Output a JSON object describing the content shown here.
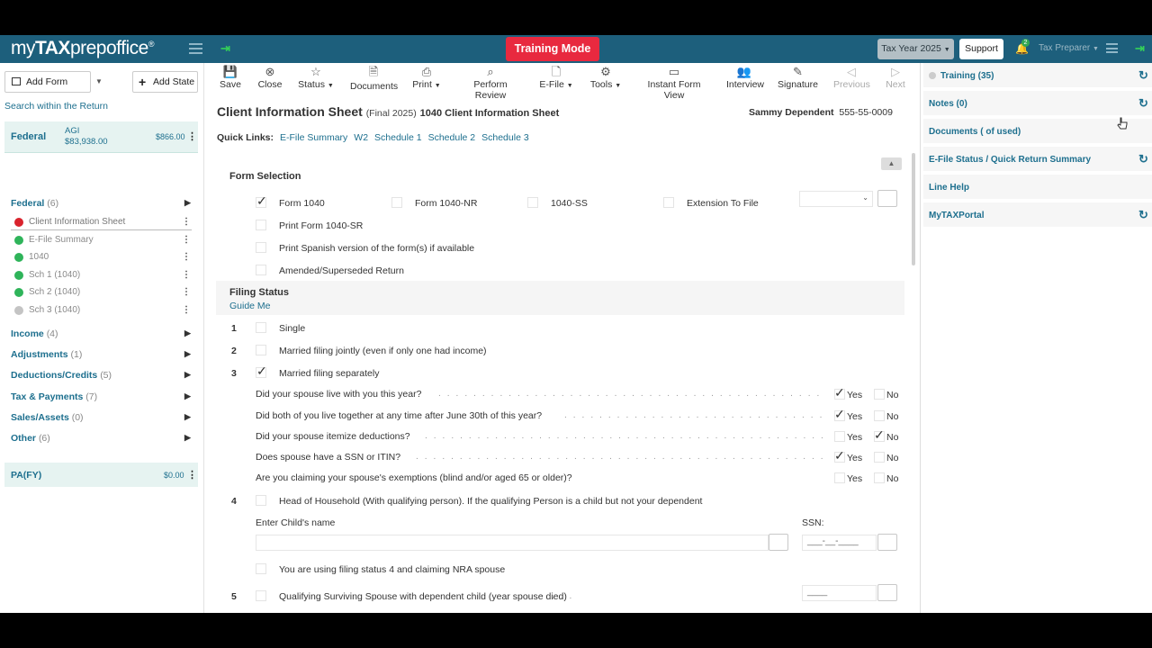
{
  "topbar": {
    "logo_my": "my",
    "logo_tax": "TAX",
    "logo_rest": "prepoffice",
    "logo_reg": "®",
    "training_mode": "Training Mode",
    "tax_year": "Tax Year 2025",
    "support": "Support",
    "notif_count": "2",
    "user_menu": "Tax Preparer"
  },
  "left": {
    "add_form": "Add Form",
    "add_state": "Add State",
    "search": "Search within the Return",
    "federal": {
      "label": "Federal",
      "agi_label": "AGI",
      "agi_value": "$83,938.00",
      "amount": "$866.00"
    },
    "federal_group": {
      "label": "Federal",
      "count": "(6)"
    },
    "items": [
      {
        "label": "Client Information Sheet",
        "status": "red"
      },
      {
        "label": "E-File Summary",
        "status": "green"
      },
      {
        "label": "1040",
        "status": "green"
      },
      {
        "label": "Sch 1 (1040)",
        "status": "green"
      },
      {
        "label": "Sch 2 (1040)",
        "status": "green"
      },
      {
        "label": "Sch 3 (1040)",
        "status": "grey"
      }
    ],
    "sections": [
      {
        "label": "Income",
        "count": "(4)"
      },
      {
        "label": "Adjustments",
        "count": "(1)"
      },
      {
        "label": "Deductions/Credits",
        "count": "(5)"
      },
      {
        "label": "Tax & Payments",
        "count": "(7)"
      },
      {
        "label": "Sales/Assets",
        "count": "(0)"
      },
      {
        "label": "Other",
        "count": "(6)"
      }
    ],
    "pa": {
      "label": "PA(FY)",
      "amount": "$0.00"
    }
  },
  "toolbar": [
    {
      "label": "Save",
      "icon": "save-icon"
    },
    {
      "label": "Close",
      "icon": "close-icon"
    },
    {
      "label": "Status",
      "icon": "star-icon"
    },
    {
      "label": "Documents",
      "icon": "documents-icon"
    },
    {
      "label": "Print",
      "icon": "print-icon"
    },
    {
      "label": "Perform Review",
      "icon": "search-icon"
    },
    {
      "label": "E-File",
      "icon": "file-icon"
    },
    {
      "label": "Tools",
      "icon": "gear-icon"
    },
    {
      "label": "Instant Form View",
      "icon": "monitor-icon"
    },
    {
      "label": "Interview",
      "icon": "interview-icon"
    },
    {
      "label": "Signature",
      "icon": "pen-icon"
    },
    {
      "label": "Previous",
      "icon": "arrow-left-icon"
    },
    {
      "label": "Next",
      "icon": "arrow-right-icon"
    }
  ],
  "form": {
    "title": "Client Information Sheet",
    "subtitle": "(Final 2025)",
    "form_name": "1040 Client Information Sheet",
    "client_name": "Sammy Dependent",
    "client_ssn": "555-55-0009",
    "quick_links_label": "Quick Links:",
    "quick_links": [
      "E-File Summary",
      "W2",
      "Schedule 1",
      "Schedule 2",
      "Schedule 3"
    ],
    "form_selection": {
      "title": "Form Selection",
      "form_1040": "Form 1040",
      "form_1040nr": "Form 1040-NR",
      "form_1040ss": "1040-SS",
      "extension": "Extension To File",
      "print_1040sr": "Print Form 1040-SR",
      "print_spanish": "Print Spanish version of the form(s) if available",
      "amended": "Amended/Superseded Return"
    },
    "filing_status": {
      "title": "Filing Status",
      "guide_me": "Guide Me",
      "n1": "1",
      "single": "Single",
      "n2": "2",
      "mfj": "Married filing jointly (even if only one had income)",
      "n3": "3",
      "mfs": "Married filing separately",
      "questions": [
        "Did your spouse live with you this year?",
        "Did both of you live together at any time after June 30th of this year?",
        "Did your spouse itemize deductions?",
        "Does spouse have a SSN or ITIN?",
        "Are you claiming your spouse's exemptions (blind and/or aged 65 or older)?"
      ],
      "yes": "Yes",
      "no": "No",
      "n4": "4",
      "hoh": "Head of Household (With qualifying person). If the qualifying Person is a child but not your dependent",
      "child_name": "Enter Child's name",
      "ssn_label": "SSN:",
      "ssn_mask": "___-__-____",
      "nra": "You are using filing status 4 and claiming NRA spouse",
      "n5": "5",
      "qss": "Qualifying Surviving Spouse with dependent child (year spouse died)",
      "year_mask": "____"
    }
  },
  "right": {
    "training": "Training (35)",
    "notes": "Notes (0)",
    "documents": "Documents ( of used)",
    "efile": "E-File Status / Quick Return Summary",
    "line_help": "Line Help",
    "portal": "MyTAXPortal"
  }
}
